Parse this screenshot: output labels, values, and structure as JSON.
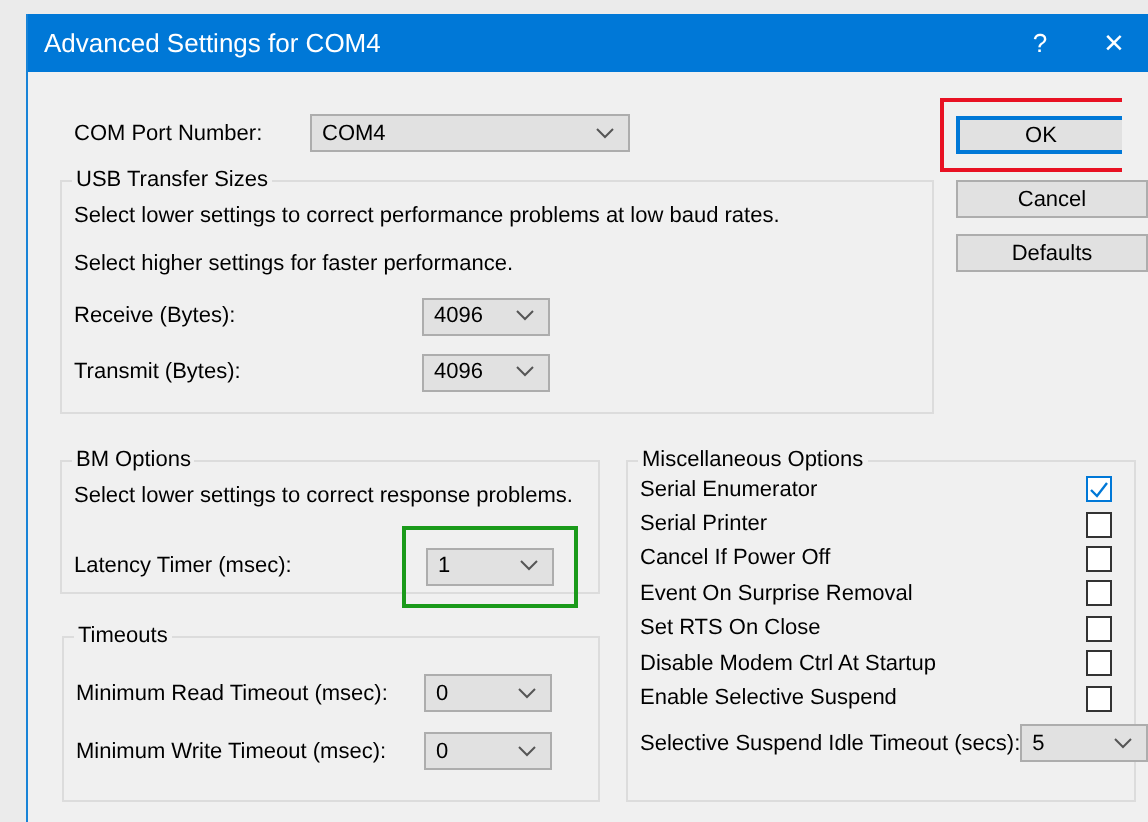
{
  "window": {
    "title": "Advanced Settings for COM4",
    "help_glyph": "?",
    "close_glyph": "×"
  },
  "com_port": {
    "label": "COM Port Number:",
    "value": "COM4"
  },
  "buttons": [
    {
      "label": "OK",
      "default": true,
      "color": "#e81123"
    },
    {
      "label": "Cancel",
      "default": false
    },
    {
      "label": "Defaults",
      "default": false
    }
  ],
  "usb_transfer": {
    "title": "USB Transfer Sizes",
    "notes": [
      "Select lower settings to correct performance problems at low baud rates.",
      "Select higher settings for faster performance."
    ],
    "fields": [
      {
        "label": "Receive (Bytes):",
        "value": "4096"
      },
      {
        "label": "Transmit (Bytes):",
        "value": "4096"
      }
    ]
  },
  "bm_options": {
    "title": "BM Options",
    "notes": [
      "Select lower settings to correct response problems."
    ],
    "fields": [
      {
        "label": "Latency Timer (msec):",
        "value": "1",
        "color": "#1a9a1a"
      }
    ]
  },
  "timeouts": {
    "title": "Timeouts",
    "fields": [
      {
        "label": "Minimum Read Timeout (msec):",
        "value": "0"
      },
      {
        "label": "Minimum Write Timeout (msec):",
        "value": "0"
      }
    ]
  },
  "misc": {
    "title": "Miscellaneous Options",
    "items": [
      {
        "kind": "checkbox",
        "label": "Serial Enumerator",
        "checked": true
      },
      {
        "kind": "checkbox",
        "label": "Serial Printer",
        "checked": false
      },
      {
        "kind": "checkbox",
        "label": "Cancel If Power Off",
        "checked": false
      },
      {
        "kind": "checkbox",
        "label": "Event On Surprise Removal",
        "checked": false
      },
      {
        "kind": "checkbox",
        "label": "Set RTS On Close",
        "checked": false
      },
      {
        "kind": "checkbox",
        "label": "Disable Modem Ctrl At Startup",
        "checked": false
      },
      {
        "kind": "checkbox",
        "label": "Enable Selective Suspend",
        "checked": false
      },
      {
        "kind": "select",
        "label": "Selective Suspend Idle Timeout (secs):",
        "value": "5"
      }
    ]
  }
}
